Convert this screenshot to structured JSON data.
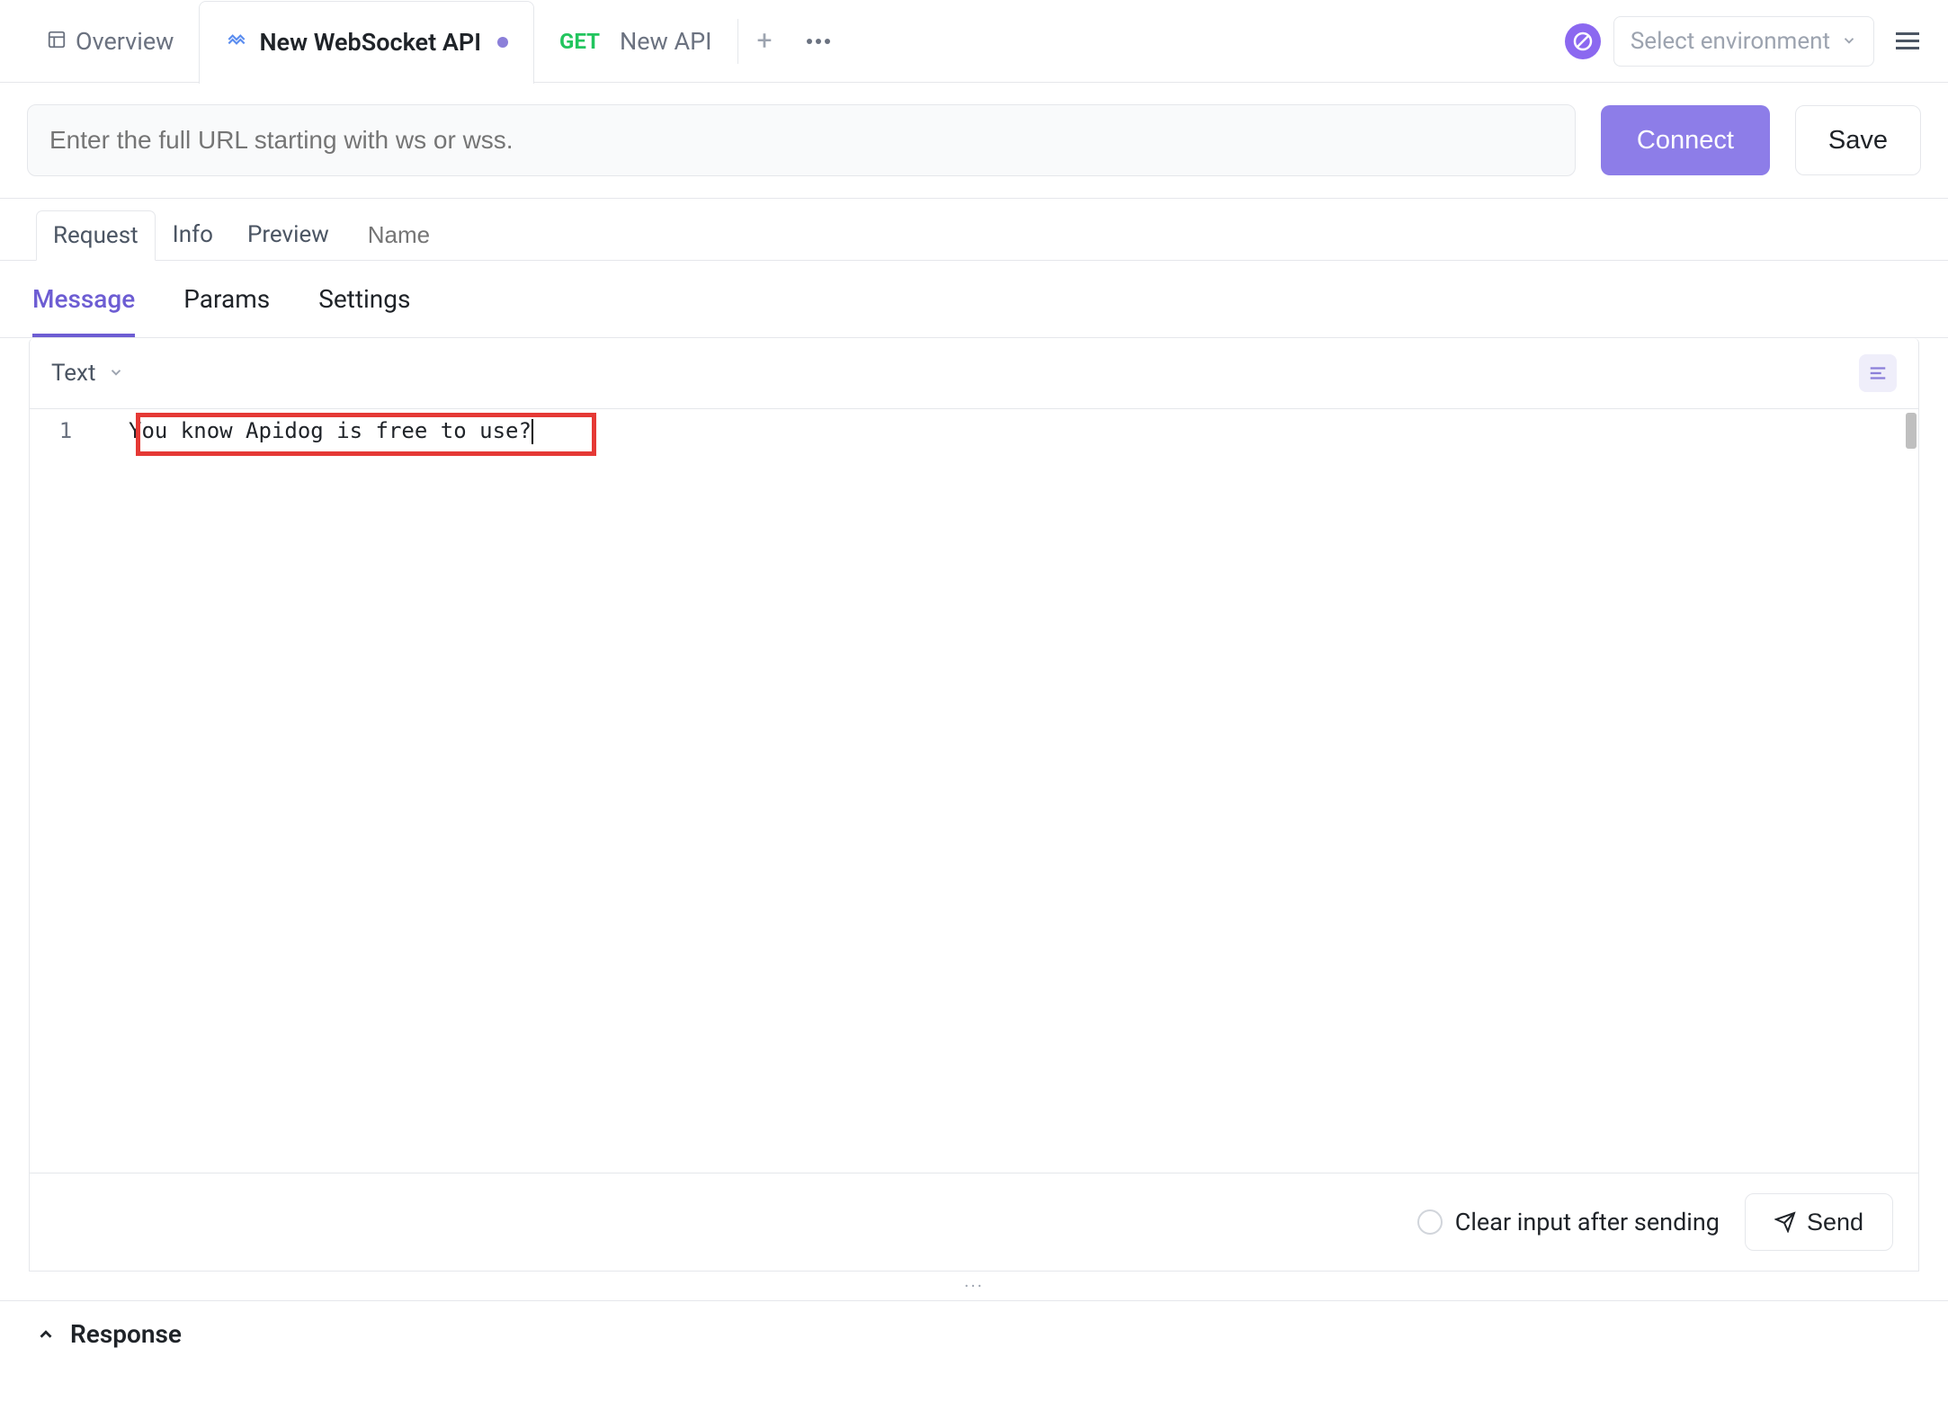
{
  "tabs": {
    "overview": "Overview",
    "active": {
      "label": "New WebSocket API",
      "modified": true
    },
    "third": {
      "method": "GET",
      "label": "New API"
    }
  },
  "env": {
    "placeholder": "Select environment"
  },
  "url": {
    "placeholder": "Enter the full URL starting with ws or wss."
  },
  "buttons": {
    "connect": "Connect",
    "save": "Save",
    "send": "Send"
  },
  "sectionTabs": {
    "request": "Request",
    "info": "Info",
    "preview": "Preview",
    "namePlaceholder": "Name"
  },
  "contentTabs": {
    "message": "Message",
    "params": "Params",
    "settings": "Settings",
    "active": "message"
  },
  "editor": {
    "format": "Text",
    "lineNumber": "1",
    "code": "You know Apidog is free to use?"
  },
  "footer": {
    "clearInput": "Clear input after sending"
  },
  "response": {
    "label": "Response"
  },
  "dragDots": "···"
}
